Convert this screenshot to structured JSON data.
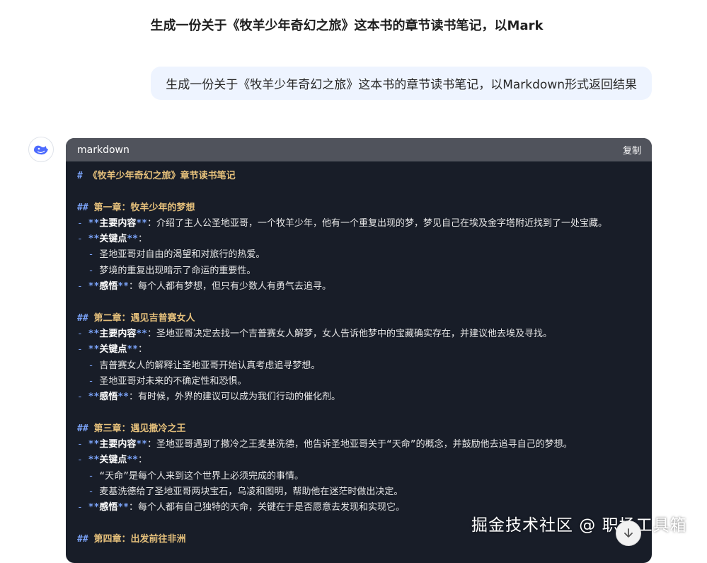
{
  "page_title": "生成一份关于《牧羊少年奇幻之旅》这本书的章节读书笔记，以Mark",
  "user_message": "生成一份关于《牧羊少年奇幻之旅》这本书的章节读书笔记，以Markdown形式返回结果",
  "assistant": {
    "avatar_icon": "deepseek-whale-logo",
    "code_block": {
      "language": "markdown",
      "copy_label": "复制",
      "lines": [
        {
          "type": "h1",
          "hash": "#",
          "text": "《牧羊少年奇幻之旅》章节读书笔记"
        },
        {
          "type": "blank"
        },
        {
          "type": "h2",
          "hash": "##",
          "text": "第一章：牧羊少年的梦想"
        },
        {
          "type": "item",
          "dash": "-",
          "bold": "主要内容",
          "rest": "：介绍了主人公圣地亚哥，一个牧羊少年，他有一个重复出现的梦，梦见自己在埃及金字塔附近找到了一处宝藏。"
        },
        {
          "type": "item",
          "dash": "-",
          "bold": "关键点",
          "rest": "："
        },
        {
          "type": "sub",
          "dash": "  -",
          "text": "圣地亚哥对自由的渴望和对旅行的热爱。"
        },
        {
          "type": "sub",
          "dash": "  -",
          "text": "梦境的重复出现暗示了命运的重要性。"
        },
        {
          "type": "item",
          "dash": "-",
          "bold": "感悟",
          "rest": "：每个人都有梦想，但只有少数人有勇气去追寻。"
        },
        {
          "type": "blank"
        },
        {
          "type": "h2",
          "hash": "##",
          "text": "第二章：遇见吉普赛女人"
        },
        {
          "type": "item",
          "dash": "-",
          "bold": "主要内容",
          "rest": "：圣地亚哥决定去找一个吉普赛女人解梦，女人告诉他梦中的宝藏确实存在，并建议他去埃及寻找。"
        },
        {
          "type": "item",
          "dash": "-",
          "bold": "关键点",
          "rest": "："
        },
        {
          "type": "sub",
          "dash": "  -",
          "text": "吉普赛女人的解释让圣地亚哥开始认真考虑追寻梦想。"
        },
        {
          "type": "sub",
          "dash": "  -",
          "text": "圣地亚哥对未来的不确定性和恐惧。"
        },
        {
          "type": "item",
          "dash": "-",
          "bold": "感悟",
          "rest": "：有时候，外界的建议可以成为我们行动的催化剂。"
        },
        {
          "type": "blank"
        },
        {
          "type": "h2",
          "hash": "##",
          "text": "第三章：遇见撒冷之王"
        },
        {
          "type": "item",
          "dash": "-",
          "bold": "主要内容",
          "rest": "：圣地亚哥遇到了撒冷之王麦基洗德，他告诉圣地亚哥关于“天命”的概念，并鼓励他去追寻自己的梦想。"
        },
        {
          "type": "item",
          "dash": "-",
          "bold": "关键点",
          "rest": "："
        },
        {
          "type": "sub",
          "dash": "  -",
          "text": "“天命”是每个人来到这个世界上必须完成的事情。"
        },
        {
          "type": "sub",
          "dash": "  -",
          "text": "麦基洗德给了圣地亚哥两块宝石，乌凌和图明，帮助他在迷茫时做出决定。"
        },
        {
          "type": "item",
          "dash": "-",
          "bold": "感悟",
          "rest": "：每个人都有自己独特的天命，关键在于是否愿意去发现和实现它。"
        },
        {
          "type": "blank"
        },
        {
          "type": "h2",
          "hash": "##",
          "text": "第四章：出发前往非洲"
        }
      ]
    }
  },
  "watermark": "掘金技术社区 @ 职场工具箱",
  "scroll_down_icon": "arrow-down-icon"
}
